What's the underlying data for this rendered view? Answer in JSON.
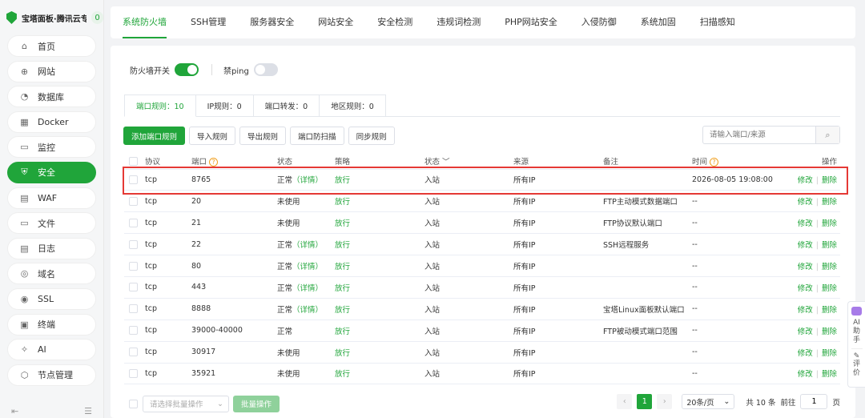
{
  "brand": {
    "title": "宝塔面板·腾讯云专享",
    "badge": "0"
  },
  "sidebar": {
    "items": [
      {
        "label": "首页",
        "icon": "home-icon"
      },
      {
        "label": "网站",
        "icon": "globe-icon"
      },
      {
        "label": "数据库",
        "icon": "database-icon"
      },
      {
        "label": "Docker",
        "icon": "docker-icon"
      },
      {
        "label": "监控",
        "icon": "monitor-icon"
      },
      {
        "label": "安全",
        "icon": "shield-icon",
        "active": true
      },
      {
        "label": "WAF",
        "icon": "waf-icon"
      },
      {
        "label": "文件",
        "icon": "folder-icon"
      },
      {
        "label": "日志",
        "icon": "log-icon"
      },
      {
        "label": "域名",
        "icon": "domain-icon"
      },
      {
        "label": "SSL",
        "icon": "ssl-icon"
      },
      {
        "label": "终端",
        "icon": "terminal-icon"
      },
      {
        "label": "AI",
        "icon": "ai-icon"
      },
      {
        "label": "节点管理",
        "icon": "node-icon"
      }
    ]
  },
  "tabs": [
    "系统防火墙",
    "SSH管理",
    "服务器安全",
    "网站安全",
    "安全检测",
    "违规词检测",
    "PHP网站安全",
    "入侵防御",
    "系统加固",
    "扫描感知"
  ],
  "switches": {
    "firewall_label": "防火墙开关",
    "ping_label": "禁ping"
  },
  "subtabs": [
    "端口规则：10",
    "IP规则：0",
    "端口转发：0",
    "地区规则：0"
  ],
  "toolbar": {
    "add": "添加端口规则",
    "import": "导入规则",
    "export": "导出规则",
    "scan": "端口防扫描",
    "sync": "同步规则"
  },
  "search": {
    "placeholder": "请输入端口/来源"
  },
  "table": {
    "headers": {
      "protocol": "协议",
      "port": "端口",
      "status": "状态",
      "policy": "策略",
      "direction": "状态",
      "source": "来源",
      "note": "备注",
      "time": "时间",
      "ops": "操作"
    },
    "detail": "（详情）",
    "edit": "修改",
    "delete": "删除",
    "rows": [
      {
        "protocol": "tcp",
        "port": "8765",
        "status": "正常",
        "detail": true,
        "policy": "放行",
        "direction": "入站",
        "source": "所有IP",
        "note": "",
        "time": "2026-08-05 19:08:00"
      },
      {
        "protocol": "tcp",
        "port": "20",
        "status": "未使用",
        "detail": false,
        "policy": "放行",
        "direction": "入站",
        "source": "所有IP",
        "note": "FTP主动模式数据端口",
        "time": "--"
      },
      {
        "protocol": "tcp",
        "port": "21",
        "status": "未使用",
        "detail": false,
        "policy": "放行",
        "direction": "入站",
        "source": "所有IP",
        "note": "FTP协议默认端口",
        "time": "--"
      },
      {
        "protocol": "tcp",
        "port": "22",
        "status": "正常",
        "detail": true,
        "policy": "放行",
        "direction": "入站",
        "source": "所有IP",
        "note": "SSH远程服务",
        "time": "--"
      },
      {
        "protocol": "tcp",
        "port": "80",
        "status": "正常",
        "detail": true,
        "policy": "放行",
        "direction": "入站",
        "source": "所有IP",
        "note": "",
        "time": "--"
      },
      {
        "protocol": "tcp",
        "port": "443",
        "status": "正常",
        "detail": true,
        "policy": "放行",
        "direction": "入站",
        "source": "所有IP",
        "note": "",
        "time": "--"
      },
      {
        "protocol": "tcp",
        "port": "8888",
        "status": "正常",
        "detail": true,
        "policy": "放行",
        "direction": "入站",
        "source": "所有IP",
        "note": "宝塔Linux面板默认端口",
        "time": "--"
      },
      {
        "protocol": "tcp",
        "port": "39000-40000",
        "status": "正常",
        "detail": false,
        "policy": "放行",
        "direction": "入站",
        "source": "所有IP",
        "note": "FTP被动模式端口范围",
        "time": "--"
      },
      {
        "protocol": "tcp",
        "port": "30917",
        "status": "未使用",
        "detail": false,
        "policy": "放行",
        "direction": "入站",
        "source": "所有IP",
        "note": "",
        "time": "--"
      },
      {
        "protocol": "tcp",
        "port": "35921",
        "status": "未使用",
        "detail": false,
        "policy": "放行",
        "direction": "入站",
        "source": "所有IP",
        "note": "",
        "time": "--"
      }
    ]
  },
  "footer": {
    "batch_placeholder": "请选择批量操作",
    "batch_button": "批量操作",
    "page": "1",
    "page_size": "20条/页",
    "total": "共 10 条",
    "goto": "前往",
    "goto_value": "1",
    "page_unit": "页"
  },
  "float": {
    "ai": "AI助手",
    "review": "评价"
  },
  "colors": {
    "accent": "#20a53a",
    "highlight": "#e53935"
  }
}
